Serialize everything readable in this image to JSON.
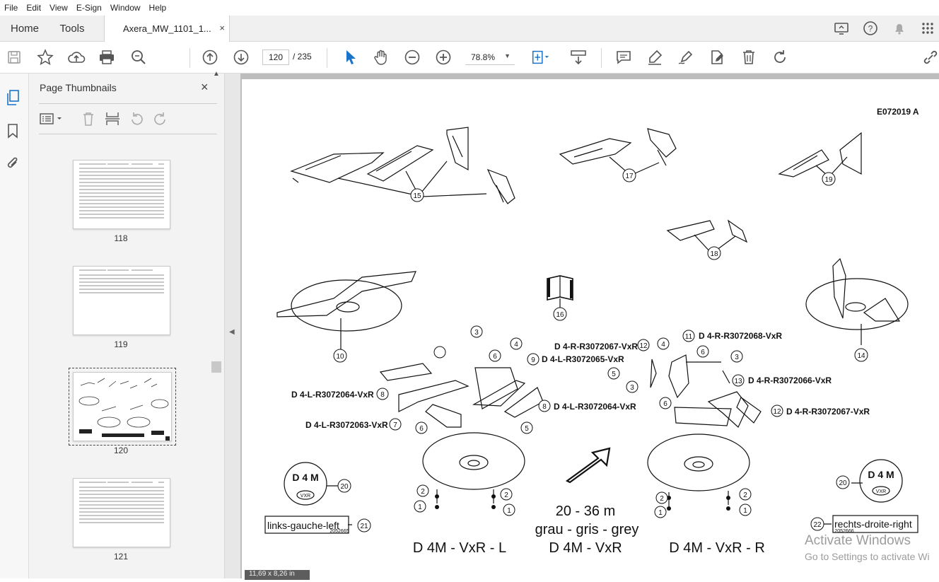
{
  "menu": [
    "File",
    "Edit",
    "View",
    "E-Sign",
    "Window",
    "Help"
  ],
  "tabs": {
    "home": "Home",
    "tools": "Tools",
    "document": "Axera_MW_1101_1...",
    "close": "×"
  },
  "toolbar": {
    "page_current": "120",
    "page_total": "/ 235",
    "zoom": "78.8%"
  },
  "panel": {
    "title": "Page Thumbnails",
    "close": "×"
  },
  "thumbnails": [
    {
      "label": "118"
    },
    {
      "label": "119"
    },
    {
      "label": "120"
    },
    {
      "label": "121"
    }
  ],
  "document": {
    "code": "E072019  A",
    "callouts": [
      "15",
      "17",
      "19",
      "18",
      "16",
      "10",
      "14",
      "3",
      "4",
      "6",
      "9",
      "11",
      "12",
      "4",
      "6",
      "3",
      "5",
      "3",
      "13",
      "8",
      "7",
      "6",
      "5",
      "8",
      "6",
      "12",
      "2",
      "1",
      "2",
      "1",
      "2",
      "1",
      "2",
      "1",
      "20",
      "20",
      "21",
      "22"
    ],
    "labels": {
      "d4l_64_left": "D  4-L-R3072064-VxR",
      "d4l_63": "D  4-L-R3072063-VxR",
      "d4l_65": "D  4-L-R3072065-VxR",
      "d4l_64_right": "D  4-L-R3072064-VxR",
      "d4r_67_top": "D  4-R-R3072067-VxR",
      "d4r_68": "D  4-R-R3072068-VxR",
      "d4r_66": "D  4-R-R3072066-VxR",
      "d4r_67_right": "D  4-R-R3072067-VxR"
    },
    "badge": {
      "main": "D 4 M",
      "sub": "VXR"
    },
    "left_tag": "links-gauche-left",
    "right_tag": "rechts-droite-right",
    "tag_small": "2052665",
    "tag_small_right": "2052666",
    "range": "20  -  36  m",
    "colors": "grau  -  gris  -  grey",
    "model_left": "D  4M  -  VxR  -  L",
    "model_center": "D  4M  -  VxR",
    "model_right": "D  4M  -  VxR  -  R"
  },
  "status": {
    "page_size": "11,69 x 8,26 in"
  },
  "watermark": {
    "line1": "Activate Windows",
    "line2": "Go to Settings to activate Wi"
  }
}
